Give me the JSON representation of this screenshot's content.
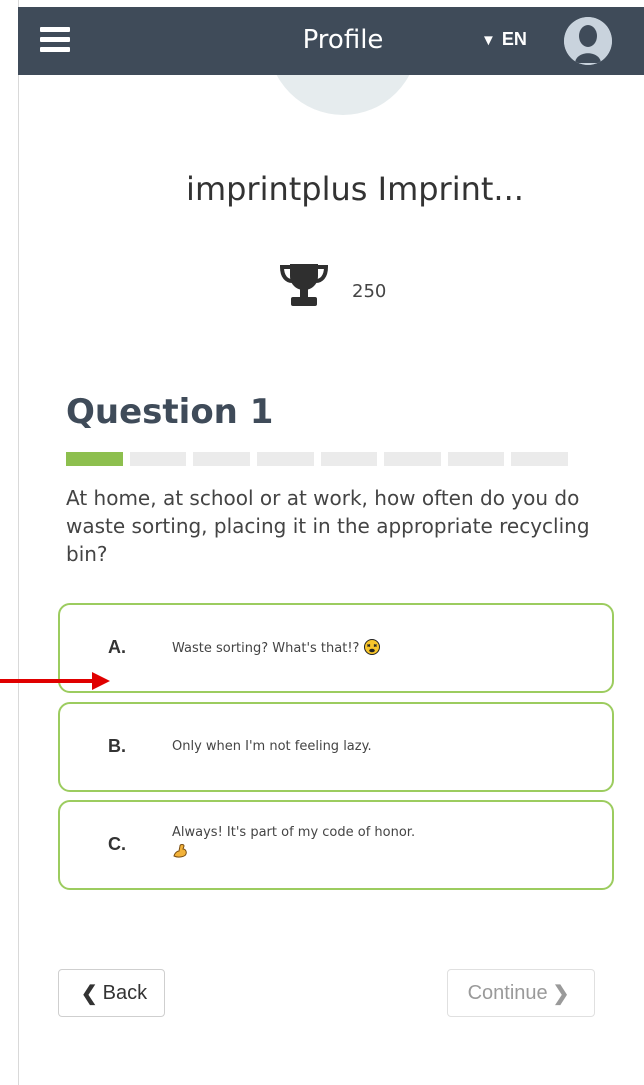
{
  "header": {
    "title": "Profile",
    "language": "EN",
    "language_caret": "▼"
  },
  "profile": {
    "name": "imprintplus Imprint...",
    "score": "250"
  },
  "question": {
    "title": "Question 1",
    "progress": {
      "current": 1,
      "total": 8
    },
    "text": "At home, at school or at work, how often do you do waste sorting, placing it in the appropriate recycling bin?"
  },
  "options": [
    {
      "letter": "A.",
      "text": "Waste sorting? What's that!?",
      "icon": "dizzy-face-emoji"
    },
    {
      "letter": "B.",
      "text": "Only when I'm not feeling lazy."
    },
    {
      "letter": "C.",
      "text": "Always! It's part of my code of honor.",
      "icon": "flexed-biceps-emoji"
    }
  ],
  "nav": {
    "back_label": "Back",
    "continue_label": "Continue"
  },
  "colors": {
    "header_bg": "#3f4b59",
    "accent_green": "#8dbf4e",
    "option_border": "#9ccc5f",
    "annotation_arrow": "#e00000"
  }
}
